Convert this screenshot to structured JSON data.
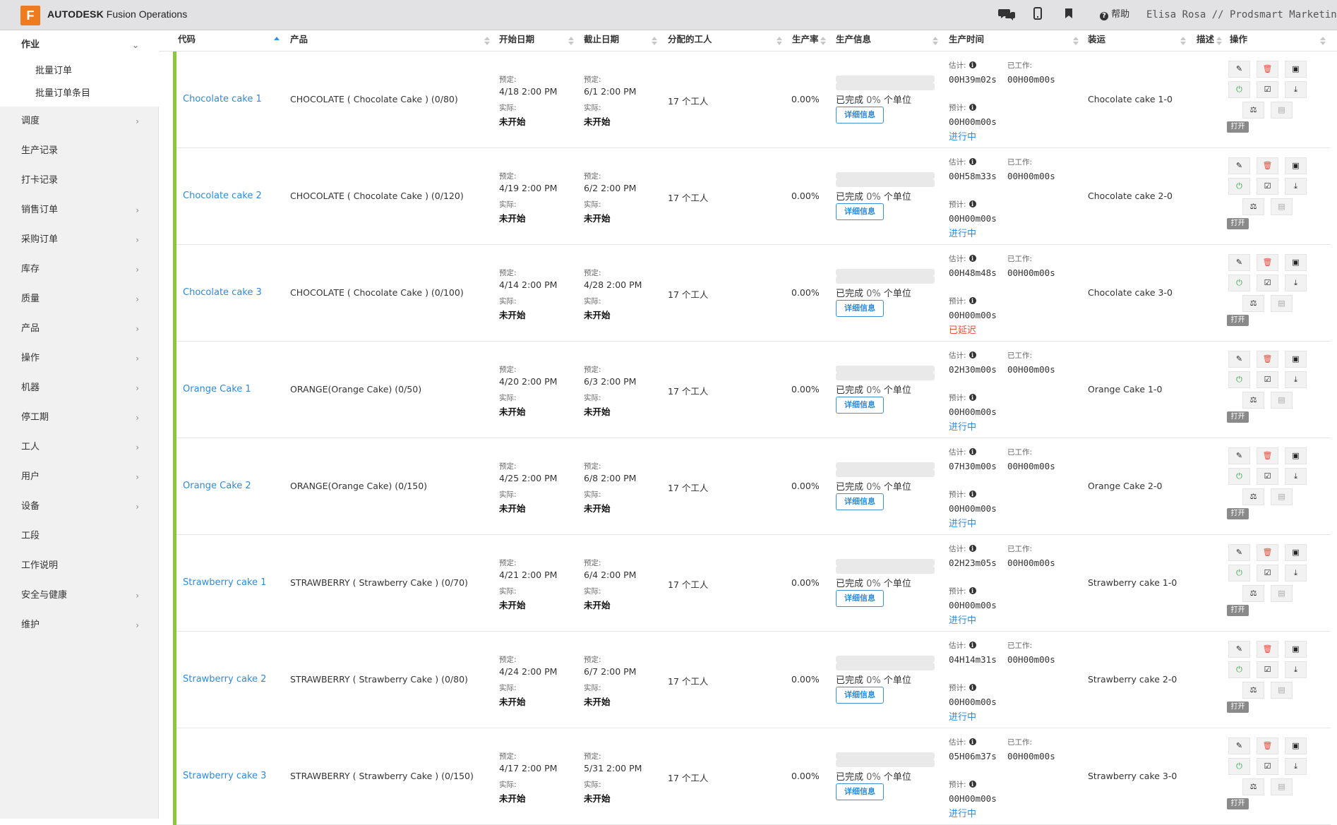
{
  "app": {
    "logo_letter": "F",
    "brand_bold": "AUTODESK",
    "brand_name": "Fusion Operations",
    "help_label": "帮助",
    "user": "Elisa Rosa // Prodsmart Marketing",
    "icons": [
      "chat-icon",
      "mobile-icon",
      "bookmark-icon",
      "help-icon"
    ]
  },
  "sidebar": {
    "active_section": "作业",
    "sub_items": [
      "批量订单",
      "批量订单条目"
    ],
    "items": [
      {
        "label": "调度",
        "chevron": true
      },
      {
        "label": "生产记录",
        "chevron": false
      },
      {
        "label": "打卡记录",
        "chevron": false
      },
      {
        "label": "销售订单",
        "chevron": true
      },
      {
        "label": "采购订单",
        "chevron": true
      },
      {
        "label": "库存",
        "chevron": true
      },
      {
        "label": "质量",
        "chevron": true
      },
      {
        "label": "产品",
        "chevron": true
      },
      {
        "label": "操作",
        "chevron": true
      },
      {
        "label": "机器",
        "chevron": true
      },
      {
        "label": "停工期",
        "chevron": true
      },
      {
        "label": "工人",
        "chevron": true
      },
      {
        "label": "用户",
        "chevron": true
      },
      {
        "label": "设备",
        "chevron": true
      },
      {
        "label": "工段",
        "chevron": false
      },
      {
        "label": "工作说明",
        "chevron": false
      },
      {
        "label": "安全与健康",
        "chevron": true
      },
      {
        "label": "维护",
        "chevron": true
      }
    ]
  },
  "table": {
    "headers": {
      "code": "代码",
      "product": "产品",
      "start": "开始日期",
      "due": "截止日期",
      "workers": "分配的工人",
      "rate": "生产率",
      "prod_info": "生产信息",
      "prod_time": "生产时间",
      "shipping": "装运",
      "desc": "描述",
      "actions": "操作"
    },
    "labels": {
      "planned": "预定:",
      "actual": "实际:",
      "not_started": "未开始",
      "completed_prefix": "已完成",
      "completed_suffix": "个单位",
      "details_btn": "详细信息",
      "estimated": "估计:",
      "worked": "已工作:",
      "forecast": "预计:",
      "open_btn": "打开"
    },
    "rows": [
      {
        "code": "Chocolate cake 1",
        "product": "CHOCOLATE ( Chocolate Cake ) (0/80)",
        "start": "4/18   2:00 PM",
        "due": "6/1   2:00 PM",
        "workers": "17 个工人",
        "rate": "0.00%",
        "pct": "0%",
        "est": "00H39m02s",
        "worked": "00H00m00s",
        "forecast": "00H00m00s",
        "status": "进行中",
        "status_type": "blue",
        "shipping": "Chocolate cake 1-0"
      },
      {
        "code": "Chocolate cake 2",
        "product": "CHOCOLATE ( Chocolate Cake ) (0/120)",
        "start": "4/19   2:00 PM",
        "due": "6/2   2:00 PM",
        "workers": "17 个工人",
        "rate": "0.00%",
        "pct": "0%",
        "est": "00H58m33s",
        "worked": "00H00m00s",
        "forecast": "00H00m00s",
        "status": "进行中",
        "status_type": "blue",
        "shipping": "Chocolate cake 2-0"
      },
      {
        "code": "Chocolate cake 3",
        "product": "CHOCOLATE ( Chocolate Cake ) (0/100)",
        "start": "4/14   2:00 PM",
        "due": "4/28   2:00 PM",
        "workers": "17 个工人",
        "rate": "0.00%",
        "pct": "0%",
        "est": "00H48m48s",
        "worked": "00H00m00s",
        "forecast": "00H00m00s",
        "status": "已延迟",
        "status_type": "red",
        "shipping": "Chocolate cake 3-0"
      },
      {
        "code": "Orange Cake 1",
        "product": "ORANGE(Orange Cake) (0/50)",
        "start": "4/20   2:00 PM",
        "due": "6/3   2:00 PM",
        "workers": "17 个工人",
        "rate": "0.00%",
        "pct": "0%",
        "est": "02H30m00s",
        "worked": "00H00m00s",
        "forecast": "00H00m00s",
        "status": "进行中",
        "status_type": "blue",
        "shipping": "Orange Cake 1-0"
      },
      {
        "code": "Orange Cake 2",
        "product": "ORANGE(Orange Cake) (0/150)",
        "start": "4/25   2:00 PM",
        "due": "6/8   2:00 PM",
        "workers": "17 个工人",
        "rate": "0.00%",
        "pct": "0%",
        "est": "07H30m00s",
        "worked": "00H00m00s",
        "forecast": "00H00m00s",
        "status": "进行中",
        "status_type": "blue",
        "shipping": "Orange Cake 2-0"
      },
      {
        "code": "Strawberry cake 1",
        "product": "STRAWBERRY ( Strawberry Cake ) (0/70)",
        "start": "4/21   2:00 PM",
        "due": "6/4   2:00 PM",
        "workers": "17 个工人",
        "rate": "0.00%",
        "pct": "0%",
        "est": "02H23m05s",
        "worked": "00H00m00s",
        "forecast": "00H00m00s",
        "status": "进行中",
        "status_type": "blue",
        "shipping": "Strawberry cake 1-0"
      },
      {
        "code": "Strawberry cake 2",
        "product": "STRAWBERRY ( Strawberry Cake ) (0/80)",
        "start": "4/24   2:00 PM",
        "due": "6/7   2:00 PM",
        "workers": "17 个工人",
        "rate": "0.00%",
        "pct": "0%",
        "est": "04H14m31s",
        "worked": "00H00m00s",
        "forecast": "00H00m00s",
        "status": "进行中",
        "status_type": "blue",
        "shipping": "Strawberry cake 2-0"
      },
      {
        "code": "Strawberry cake 3",
        "product": "STRAWBERRY ( Strawberry Cake ) (0/150)",
        "start": "4/17   2:00 PM",
        "due": "5/31   2:00 PM",
        "workers": "17 个工人",
        "rate": "0.00%",
        "pct": "0%",
        "est": "05H06m37s",
        "worked": "00H00m00s",
        "forecast": "00H00m00s",
        "status": "进行中",
        "status_type": "blue",
        "shipping": "Strawberry cake 3-0"
      }
    ]
  },
  "colors": {
    "accent": "#2f8ad7",
    "row_bar": "#8cc63e",
    "delayed": "#e84c3d",
    "logo": "#f07b1f"
  }
}
